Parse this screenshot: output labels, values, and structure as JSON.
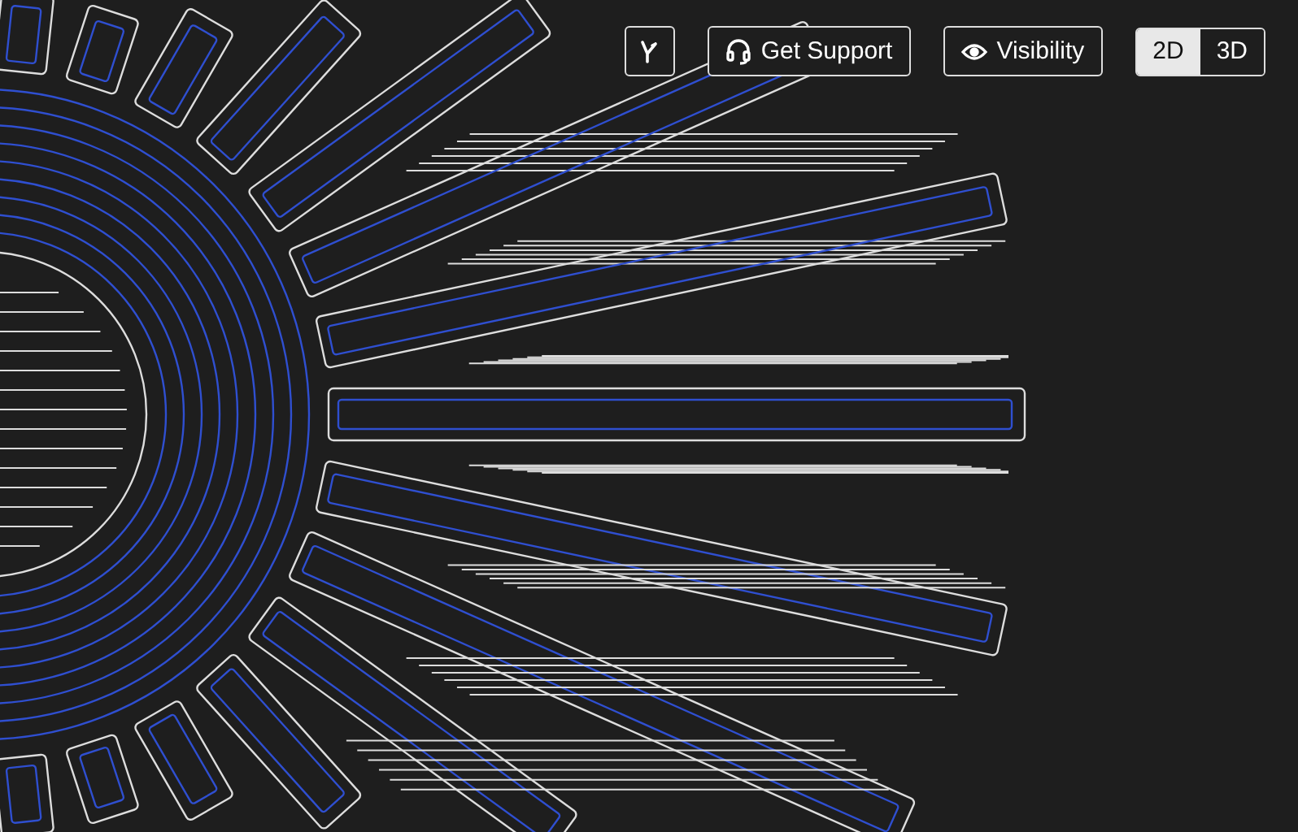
{
  "toolbar": {
    "buttons": [
      {
        "kind": "icon"
      },
      {
        "kind": "labeled",
        "label": "Get Support"
      },
      {
        "kind": "labeled",
        "label": "Visibility"
      }
    ],
    "view_modes": [
      {
        "label": "2D",
        "selected": true
      },
      {
        "label": "3D",
        "selected": false
      }
    ]
  }
}
